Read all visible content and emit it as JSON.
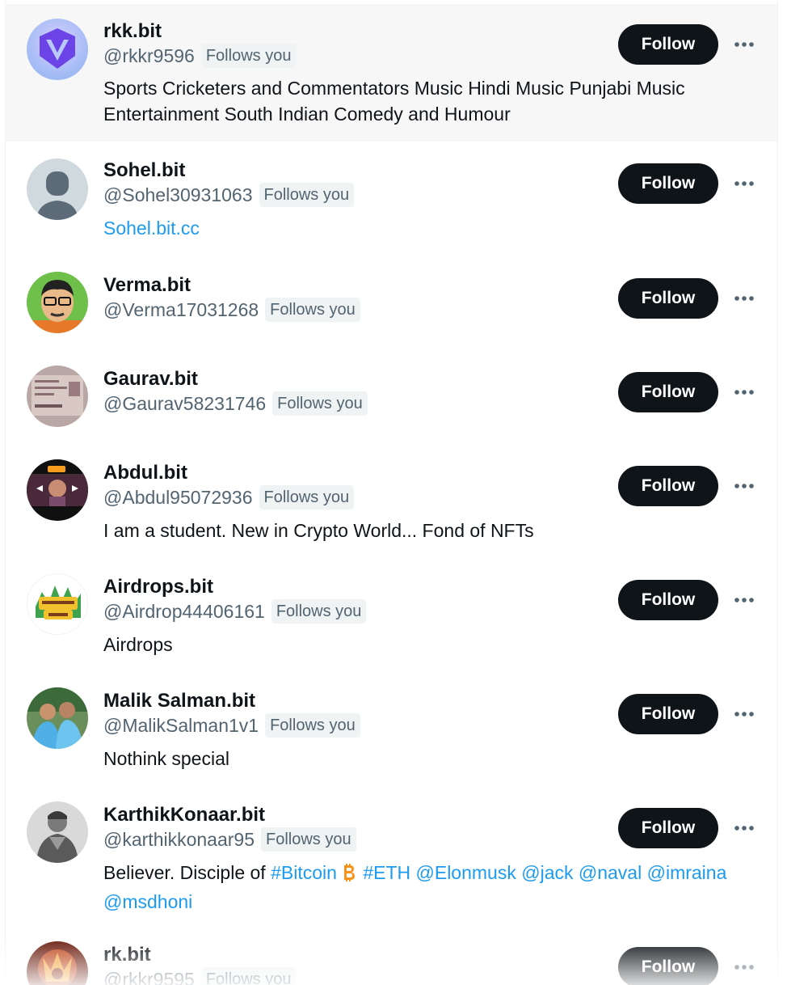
{
  "badge_label": "Follows you",
  "button_label": "Follow",
  "users": [
    {
      "name": "rkk.bit",
      "handle": "@rkkr9596",
      "bio": "Sports Cricketers and Commentators Music Hindi Music Punjabi Music Entertainment South Indian Comedy and Humour",
      "avatar": "purple-v-logo"
    },
    {
      "name": "Sohel.bit",
      "handle": "@Sohel30931063",
      "bio_link": "Sohel.bit.cc",
      "avatar": "default-profile"
    },
    {
      "name": "Verma.bit",
      "handle": "@Verma17031268",
      "avatar": "cartoon-man"
    },
    {
      "name": "Gaurav.bit",
      "handle": "@Gaurav58231746",
      "avatar": "document-photo"
    },
    {
      "name": "Abdul.bit",
      "handle": "@Abdul95072936",
      "bio": "I am a student. New in Crypto World... Fond of NFTs",
      "avatar": "video-thumbnail"
    },
    {
      "name": "Airdrops.bit",
      "handle": "@Airdrop44406161",
      "bio": "Airdrops",
      "avatar": "crypto-zoo-logo"
    },
    {
      "name": "Malik Salman.bit",
      "handle": "@MalikSalman1v1",
      "bio": "Nothink special",
      "avatar": "two-people-photo"
    },
    {
      "name": "KarthikKonaar.bit",
      "handle": "@karthikkonaar95",
      "bio_parts": [
        "Believer. Disciple of ",
        "#Bitcoin",
        " ",
        "#ETH",
        " ",
        "@Elonmusk",
        " ",
        "@jack",
        " ",
        "@naval",
        " ",
        "@imraina",
        " ",
        "@msdhoni"
      ],
      "avatar": "monochrome-portrait"
    },
    {
      "name": "rk.bit",
      "handle": "@rkkr9595",
      "avatar": "fire-warrior"
    }
  ],
  "colors": {
    "link": "#1d9bf0",
    "button": "#0f1419",
    "secondary": "#536471",
    "hover_bg": "#f7f7f7",
    "bitcoin": "#f7931a"
  }
}
